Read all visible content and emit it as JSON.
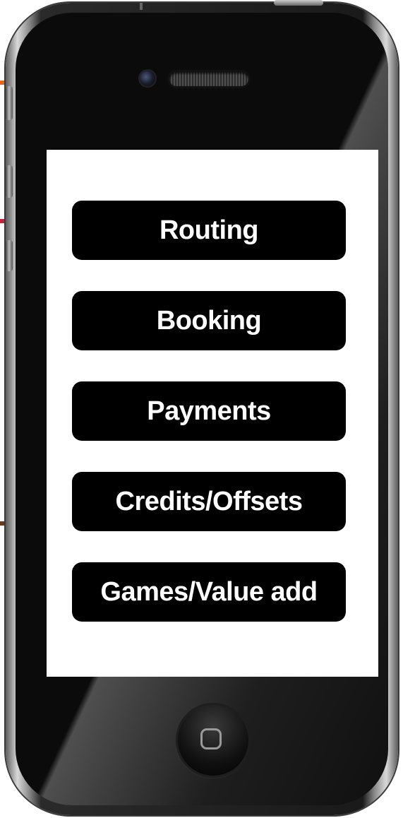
{
  "menu": {
    "items": [
      {
        "label": "Routing"
      },
      {
        "label": "Booking"
      },
      {
        "label": "Payments"
      },
      {
        "label": "Credits/Offsets"
      },
      {
        "label": "Games/Value add"
      }
    ]
  },
  "icons": {
    "home": "home-square-icon",
    "camera": "front-camera-icon",
    "speaker": "earpiece-speaker-icon"
  },
  "colors": {
    "button_background": "#000000",
    "button_text": "#ffffff",
    "screen_background": "#ffffff",
    "phone_body": "#0b0b0b"
  }
}
